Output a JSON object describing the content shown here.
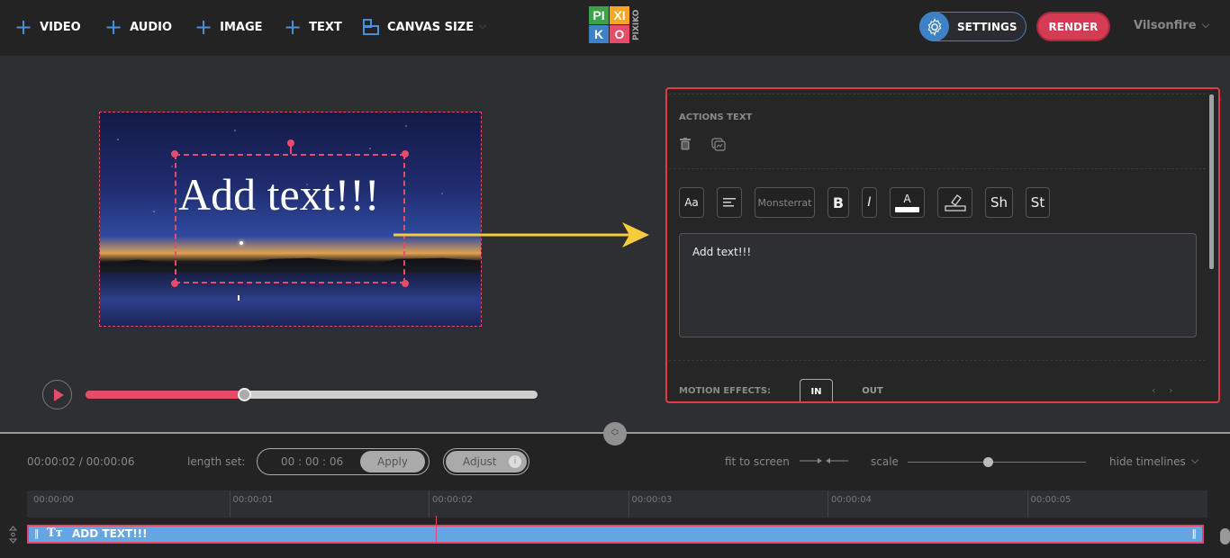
{
  "topbar": {
    "add_items": [
      {
        "label": "VIDEO",
        "icon": "plus-icon"
      },
      {
        "label": "AUDIO",
        "icon": "plus-icon"
      },
      {
        "label": "IMAGE",
        "icon": "plus-icon"
      },
      {
        "label": "TEXT",
        "icon": "plus-icon"
      }
    ],
    "canvas_size_label": "CANVAS SIZE",
    "logo": {
      "letters": [
        "PI",
        "XI",
        "K",
        "O"
      ],
      "vertical_text": "PIXIKO",
      "colors": [
        "#3aa348",
        "#f5a623",
        "#3d82c6",
        "#e84a6a"
      ]
    },
    "settings_label": "SETTINGS",
    "render_label": "RENDER",
    "user_name": "Vilsonfire"
  },
  "canvas": {
    "text_content": "Add text!!!",
    "accent_color": "#e84a6a"
  },
  "player": {
    "progress_fraction": 0.35
  },
  "panel": {
    "section_title": "ACTIONS TEXT",
    "tools": {
      "font_size": "Aa",
      "font_family": "Monsterrat",
      "bold": "B",
      "italic": "I",
      "color": "A",
      "shadow": "Sh",
      "stroke": "St"
    },
    "text_value": "Add text!!!",
    "motion_effects_label": "MOTION EFFECTS:",
    "motion_tabs": [
      "IN",
      "OUT"
    ],
    "border_color": "#e23c3c"
  },
  "timeline": {
    "time_display": "00:00:02 / 00:00:06",
    "length_set_label": "length set:",
    "length_value": "00 : 00 : 06",
    "apply_label": "Apply",
    "adjust_label": "Adjust",
    "adjust_info": "i",
    "fit_to_screen_label": "fit to screen",
    "scale_label": "scale",
    "scale_fraction": 0.45,
    "hide_timelines_label": "hide timelines",
    "ticks": [
      "00:00:00",
      "00:00:01",
      "00:00:02",
      "00:00:03",
      "00:00:04",
      "00:00:05"
    ],
    "clip_label": "ADD TEXT!!!",
    "clip_color": "#62a6e2"
  }
}
